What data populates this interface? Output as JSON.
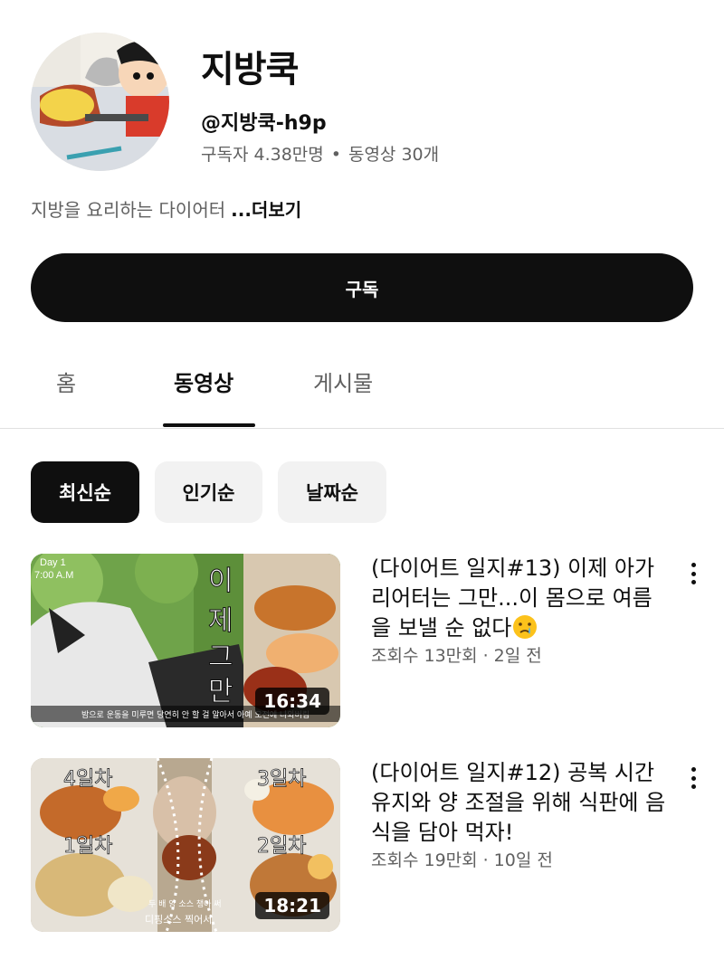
{
  "channel": {
    "name": "지방쿡",
    "handle": "@지방쿡-h9p",
    "subscribers": "구독자 4.38만명",
    "stat_separator": "•",
    "videos_count": "동영상 30개",
    "description": "지방을 요리하는 다이어터",
    "more_label": "...더보기"
  },
  "subscribe": {
    "label": "구독"
  },
  "tabs": [
    {
      "label": "홈",
      "active": false
    },
    {
      "label": "동영상",
      "active": true
    },
    {
      "label": "게시물",
      "active": false
    }
  ],
  "filters": [
    {
      "label": "최신순",
      "active": true
    },
    {
      "label": "인기순",
      "active": false
    },
    {
      "label": "날짜순",
      "active": false
    }
  ],
  "videos": [
    {
      "title": "(다이어트 일지#13) 이제 아가리어터는 그만...이 몸으로 여름을 보낼 순 없다",
      "title_emoji": "crying-face-icon",
      "views": "조회수 13만회",
      "meta_separator": "·",
      "age": "2일 전",
      "duration": "16:34",
      "thumb_text": {
        "day": "Day 1",
        "time": "7:00 A.M",
        "vertical": [
          "이",
          "제",
          "그",
          "만"
        ],
        "caption": "밤으로 운동을 미루면 당연히 안 할 걸 알아서 아예 오전에 나와버림"
      }
    },
    {
      "title": "(다이어트 일지#12) 공복 시간 유지와 양 조절을 위해 식판에 음식을 담아 먹자!",
      "views": "조회수 19만회",
      "meta_separator": "·",
      "age": "10일 전",
      "duration": "18:21",
      "thumb_text": {
        "d4": "4일차",
        "d3": "3일차",
        "d1": "1일차",
        "d2": "2일차",
        "caption1": "두 배 양 소스 챙아 써",
        "caption2": "디핑소스 찍어서"
      }
    }
  ]
}
